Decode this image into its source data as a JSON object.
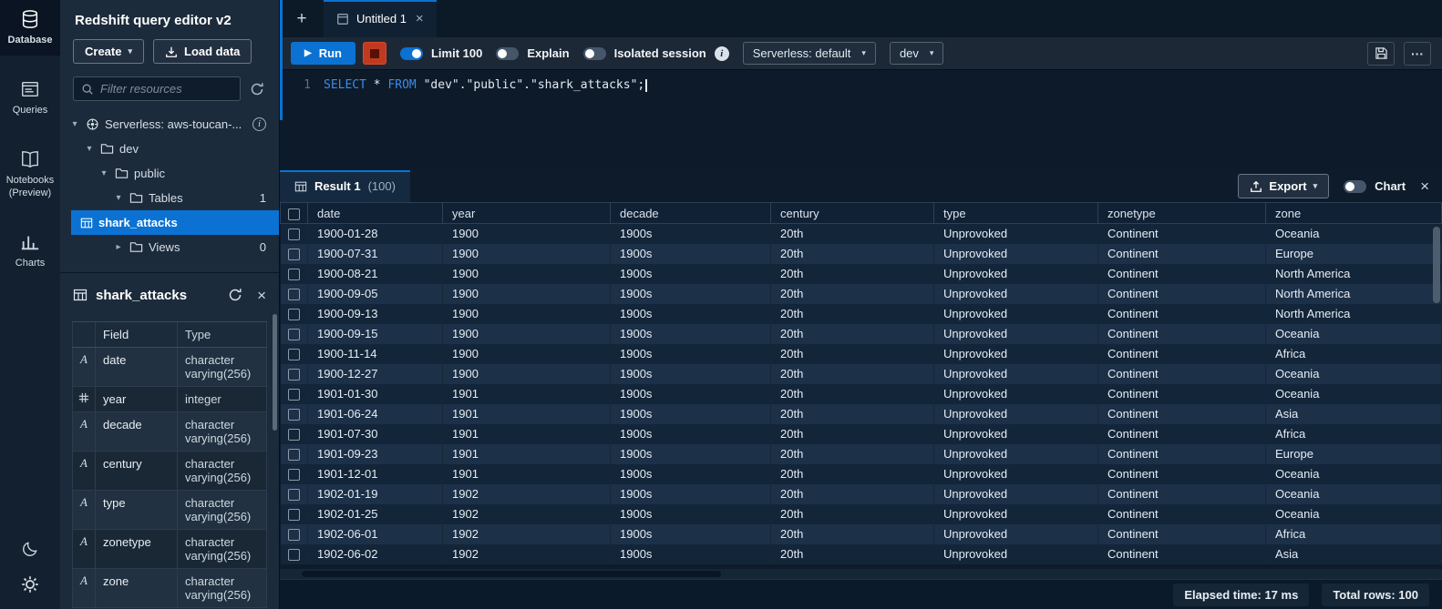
{
  "app": {
    "title": "Redshift query editor v2"
  },
  "icons": {
    "caret_down": "▾",
    "chevron_down": "▾",
    "chevron_right": "▸",
    "close": "×",
    "plus": "+",
    "play": "▶",
    "ellipsis": "···",
    "info": "i"
  },
  "rail": {
    "items": [
      {
        "label": "Database",
        "active": true
      },
      {
        "label": "Queries",
        "active": false
      },
      {
        "label": "Notebooks (Preview)",
        "active": false
      },
      {
        "label": "Charts",
        "active": false
      }
    ]
  },
  "sidebar": {
    "create_button": "Create",
    "load_data_button": "Load data",
    "filter_placeholder": "Filter resources",
    "tree": [
      {
        "label": "Serverless: aws-toucan-...",
        "expanded": true
      },
      {
        "label": "dev",
        "expanded": true
      },
      {
        "label": "public",
        "expanded": true
      },
      {
        "label": "Tables",
        "count": "1",
        "expanded": true
      },
      {
        "label": "shark_attacks",
        "selected": true
      },
      {
        "label": "Views",
        "count": "0",
        "expanded": false
      }
    ]
  },
  "table_panel": {
    "title": "shark_attacks",
    "col_field": "Field",
    "col_type": "Type",
    "fields": [
      {
        "kind": "text",
        "name": "date",
        "type": "character varying(256)"
      },
      {
        "kind": "number",
        "name": "year",
        "type": "integer"
      },
      {
        "kind": "text",
        "name": "decade",
        "type": "character varying(256)"
      },
      {
        "kind": "text",
        "name": "century",
        "type": "character varying(256)"
      },
      {
        "kind": "text",
        "name": "type",
        "type": "character varying(256)"
      },
      {
        "kind": "text",
        "name": "zonetype",
        "type": "character varying(256)"
      },
      {
        "kind": "text",
        "name": "zone",
        "type": "character varying(256)"
      }
    ]
  },
  "tabs": {
    "active_tab": "Untitled 1"
  },
  "toolbar": {
    "run_label": "Run",
    "limit_label": "Limit 100",
    "explain_label": "Explain",
    "isolated_label": "Isolated session",
    "serverless_dropdown": "Serverless: default",
    "database_dropdown": "dev",
    "limit_on": true,
    "explain_on": false,
    "isolated_on": false
  },
  "editor": {
    "line_number": "1",
    "kw_select": "SELECT",
    "t1": " * ",
    "kw_from": "FROM",
    "t2": " \"dev\".\"public\".\"shark_attacks\";"
  },
  "results": {
    "tab_label": "Result 1",
    "tab_count": "(100)",
    "export_label": "Export",
    "chart_label": "Chart",
    "columns": [
      "date",
      "year",
      "decade",
      "century",
      "type",
      "zonetype",
      "zone"
    ],
    "rows": [
      [
        "1900-01-28",
        "1900",
        "1900s",
        "20th",
        "Unprovoked",
        "Continent",
        "Oceania"
      ],
      [
        "1900-07-31",
        "1900",
        "1900s",
        "20th",
        "Unprovoked",
        "Continent",
        "Europe"
      ],
      [
        "1900-08-21",
        "1900",
        "1900s",
        "20th",
        "Unprovoked",
        "Continent",
        "North America"
      ],
      [
        "1900-09-05",
        "1900",
        "1900s",
        "20th",
        "Unprovoked",
        "Continent",
        "North America"
      ],
      [
        "1900-09-13",
        "1900",
        "1900s",
        "20th",
        "Unprovoked",
        "Continent",
        "North America"
      ],
      [
        "1900-09-15",
        "1900",
        "1900s",
        "20th",
        "Unprovoked",
        "Continent",
        "Oceania"
      ],
      [
        "1900-11-14",
        "1900",
        "1900s",
        "20th",
        "Unprovoked",
        "Continent",
        "Africa"
      ],
      [
        "1900-12-27",
        "1900",
        "1900s",
        "20th",
        "Unprovoked",
        "Continent",
        "Oceania"
      ],
      [
        "1901-01-30",
        "1901",
        "1900s",
        "20th",
        "Unprovoked",
        "Continent",
        "Oceania"
      ],
      [
        "1901-06-24",
        "1901",
        "1900s",
        "20th",
        "Unprovoked",
        "Continent",
        "Asia"
      ],
      [
        "1901-07-30",
        "1901",
        "1900s",
        "20th",
        "Unprovoked",
        "Continent",
        "Africa"
      ],
      [
        "1901-09-23",
        "1901",
        "1900s",
        "20th",
        "Unprovoked",
        "Continent",
        "Europe"
      ],
      [
        "1901-12-01",
        "1901",
        "1900s",
        "20th",
        "Unprovoked",
        "Continent",
        "Oceania"
      ],
      [
        "1902-01-19",
        "1902",
        "1900s",
        "20th",
        "Unprovoked",
        "Continent",
        "Oceania"
      ],
      [
        "1902-01-25",
        "1902",
        "1900s",
        "20th",
        "Unprovoked",
        "Continent",
        "Oceania"
      ],
      [
        "1902-06-01",
        "1902",
        "1900s",
        "20th",
        "Unprovoked",
        "Continent",
        "Africa"
      ],
      [
        "1902-06-02",
        "1902",
        "1900s",
        "20th",
        "Unprovoked",
        "Continent",
        "Asia"
      ]
    ],
    "status": {
      "elapsed": "Elapsed time: 17 ms",
      "total": "Total rows: 100"
    }
  },
  "colors": {
    "accent_blue": "#0b72d3",
    "stop_red": "#d13212",
    "panel_bg": "#1c2b3b",
    "editor_bg": "#0c1a2a"
  }
}
